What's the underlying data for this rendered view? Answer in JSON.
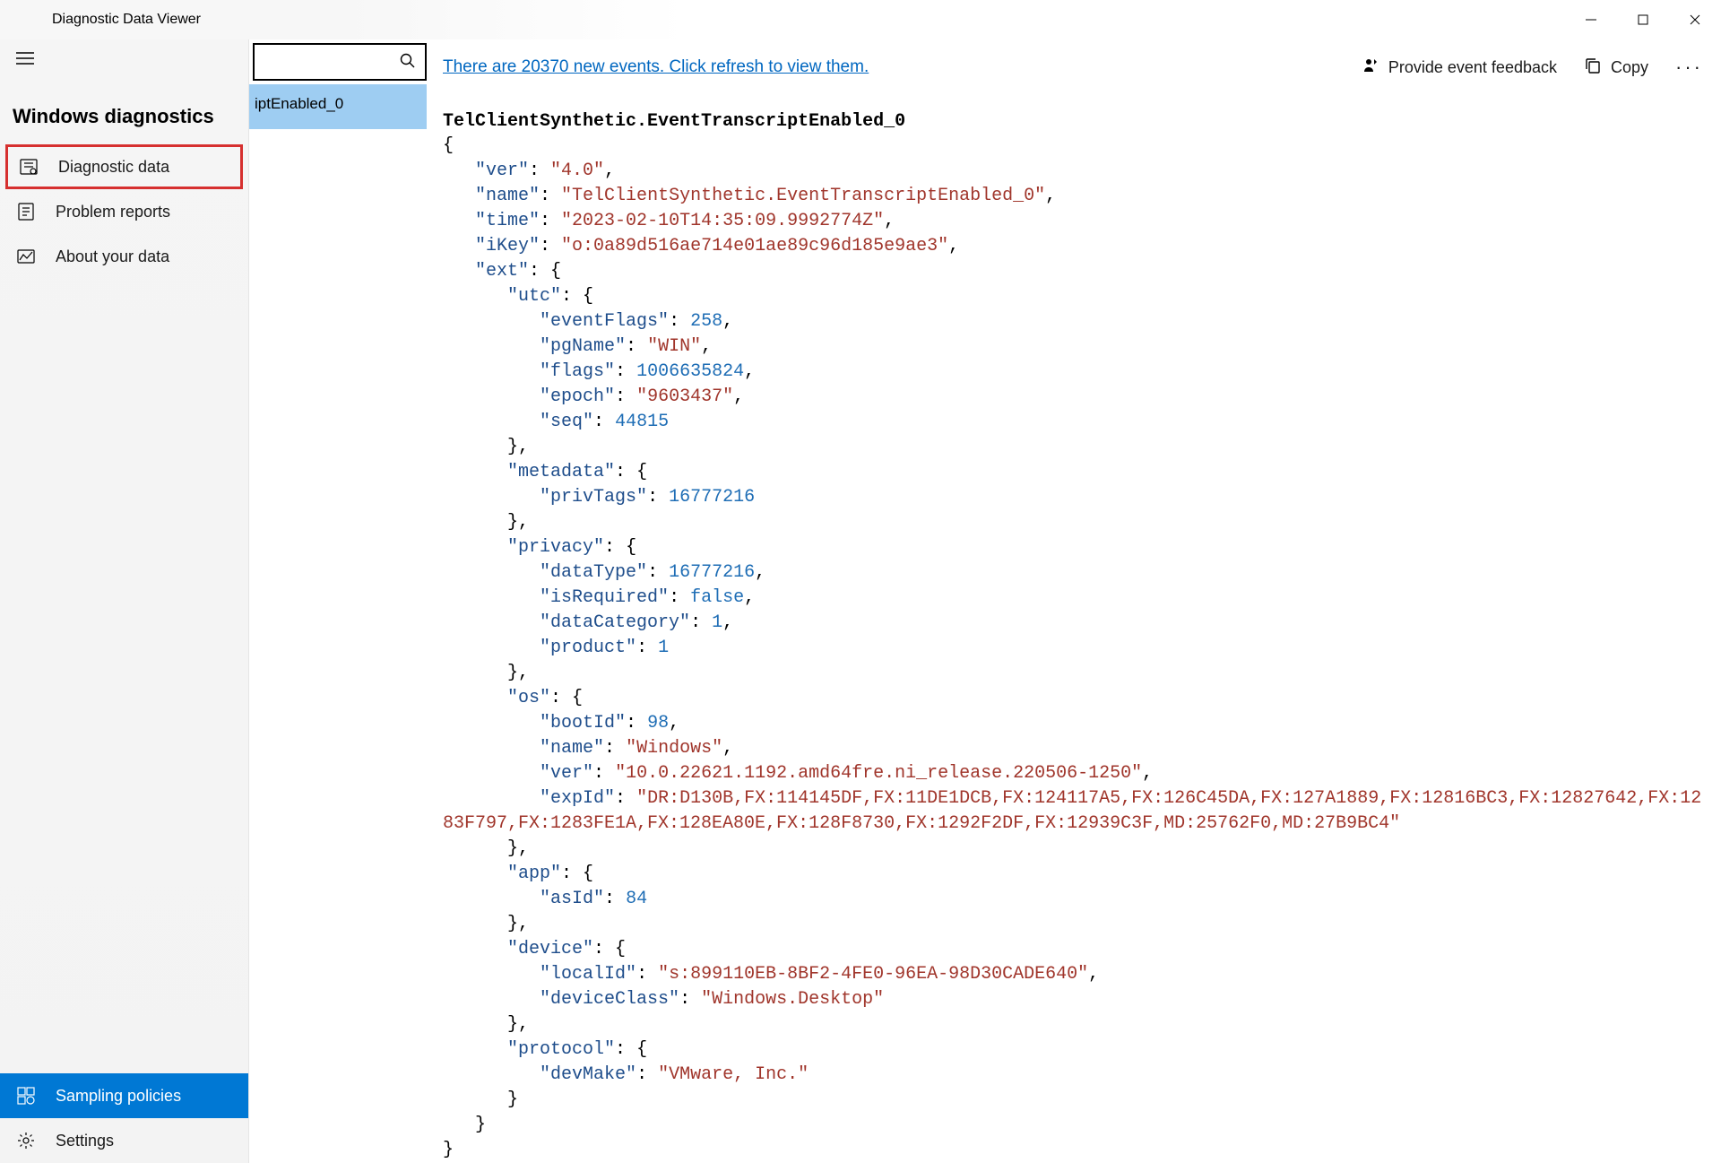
{
  "titlebar": {
    "title": "Diagnostic Data Viewer"
  },
  "sidebar": {
    "heading": "Windows diagnostics",
    "items": [
      {
        "label": "Diagnostic data",
        "highlighted": true
      },
      {
        "label": "Problem reports"
      },
      {
        "label": "About your data"
      }
    ],
    "bottom": [
      {
        "label": "Sampling policies",
        "active": true
      },
      {
        "label": "Settings"
      }
    ]
  },
  "eventList": {
    "selected": "iptEnabled_0"
  },
  "content": {
    "refresh_link": "There are 20370 new events. Click refresh to view them.",
    "actions": {
      "feedback": "Provide event feedback",
      "copy": "Copy"
    },
    "event_title": "TelClientSynthetic.EventTranscriptEnabled_0",
    "event_json": {
      "ver": "4.0",
      "name": "TelClientSynthetic.EventTranscriptEnabled_0",
      "time": "2023-02-10T14:35:09.9992774Z",
      "iKey": "o:0a89d516ae714e01ae89c96d185e9ae3",
      "ext": {
        "utc": {
          "eventFlags": 258,
          "pgName": "WIN",
          "flags": 1006635824,
          "epoch": "9603437",
          "seq": 44815
        },
        "metadata": {
          "privTags": 16777216
        },
        "privacy": {
          "dataType": 16777216,
          "isRequired": false,
          "dataCategory": 1,
          "product": 1
        },
        "os": {
          "bootId": 98,
          "name": "Windows",
          "ver": "10.0.22621.1192.amd64fre.ni_release.220506-1250",
          "expId": "DR:D130B,FX:114145DF,FX:11DE1DCB,FX:124117A5,FX:126C45DA,FX:127A1889,FX:12816BC3,FX:12827642,FX:1283F797,FX:1283FE1A,FX:128EA80E,FX:128F8730,FX:1292F2DF,FX:12939C3F,MD:25762F0,MD:27B9BC4"
        },
        "app": {
          "asId": 84
        },
        "device": {
          "localId": "s:899110EB-8BF2-4FE0-96EA-98D30CADE640",
          "deviceClass": "Windows.Desktop"
        },
        "protocol": {
          "devMake": "VMware, Inc."
        }
      }
    }
  }
}
